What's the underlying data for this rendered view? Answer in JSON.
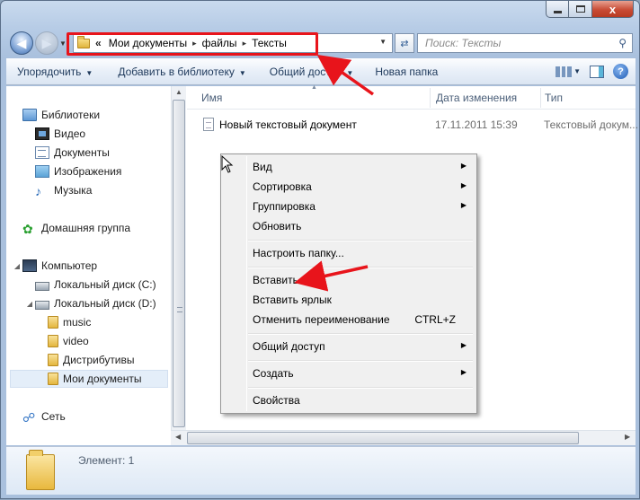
{
  "window": {
    "caption_buttons": [
      "minimize",
      "maximize",
      "close"
    ],
    "close_glyph": "x"
  },
  "address": {
    "prefix": "«",
    "crumbs": [
      "Мои документы",
      "файлы",
      "Тексты"
    ],
    "separator": "▸"
  },
  "search": {
    "placeholder": "Поиск: Тексты",
    "icon": "magnifier-icon"
  },
  "toolbar": {
    "organize": "Упорядочить",
    "add_to_library": "Добавить в библиотеку",
    "share": "Общий доступ",
    "new_folder": "Новая папка"
  },
  "sidebar": {
    "libraries": "Библиотеки",
    "video": "Видео",
    "documents": "Документы",
    "images": "Изображения",
    "music": "Музыка",
    "homegroup": "Домашняя группа",
    "computer": "Компьютер",
    "disk_c": "Локальный диск (C:)",
    "disk_d": "Локальный диск (D:)",
    "folder_music": "music",
    "folder_video": "video",
    "folder_distr": "Дистрибутивы",
    "folder_mydocs": "Мои документы",
    "network": "Сеть"
  },
  "columns": {
    "name": "Имя",
    "date": "Дата изменения",
    "type": "Тип"
  },
  "files": [
    {
      "name": "Новый текстовый документ",
      "date": "17.11.2011 15:39",
      "type": "Текстовый докум..."
    }
  ],
  "context_menu": {
    "view": "Вид",
    "sort": "Сортировка",
    "group": "Группировка",
    "refresh": "Обновить",
    "customize": "Настроить папку...",
    "paste": "Вставить",
    "paste_shortcut": "Вставить ярлык",
    "undo_rename": "Отменить переименование",
    "undo_shortcut": "CTRL+Z",
    "share": "Общий доступ",
    "new": "Создать",
    "properties": "Свойства"
  },
  "details": {
    "count": "Элемент: 1"
  },
  "colors": {
    "annotation": "#e8141b",
    "accent": "#1e395b"
  }
}
